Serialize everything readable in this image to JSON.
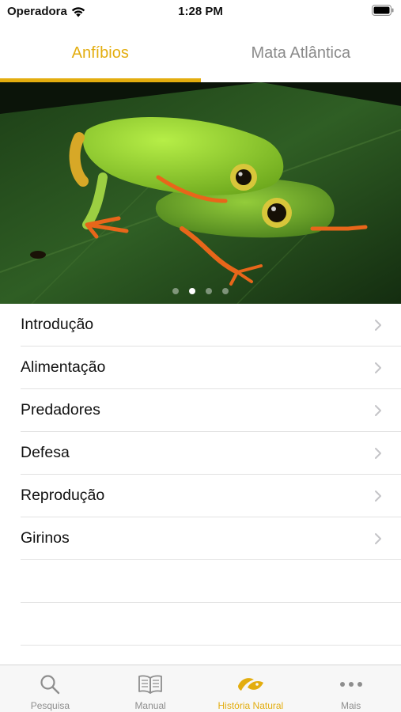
{
  "status_bar": {
    "carrier": "Operadora",
    "time": "1:28 PM"
  },
  "segments": [
    {
      "label": "Anfíbios",
      "active": true
    },
    {
      "label": "Mata Atlântica",
      "active": false
    }
  ],
  "carousel": {
    "page_count": 4,
    "current_page": 2
  },
  "menu": {
    "items": [
      {
        "label": "Introdução"
      },
      {
        "label": "Alimentação"
      },
      {
        "label": "Predadores"
      },
      {
        "label": "Defesa"
      },
      {
        "label": "Reprodução"
      },
      {
        "label": "Girinos"
      }
    ]
  },
  "tabbar": {
    "items": [
      {
        "label": "Pesquisa",
        "icon": "search-icon",
        "active": false
      },
      {
        "label": "Manual",
        "icon": "book-icon",
        "active": false
      },
      {
        "label": "História Natural",
        "icon": "leaf-frog-icon",
        "active": true
      },
      {
        "label": "Mais",
        "icon": "more-icon",
        "active": false
      }
    ]
  },
  "colors": {
    "accent": "#e3ad0f",
    "inactive": "#8e8e8e",
    "separator": "#e2e2e2"
  }
}
